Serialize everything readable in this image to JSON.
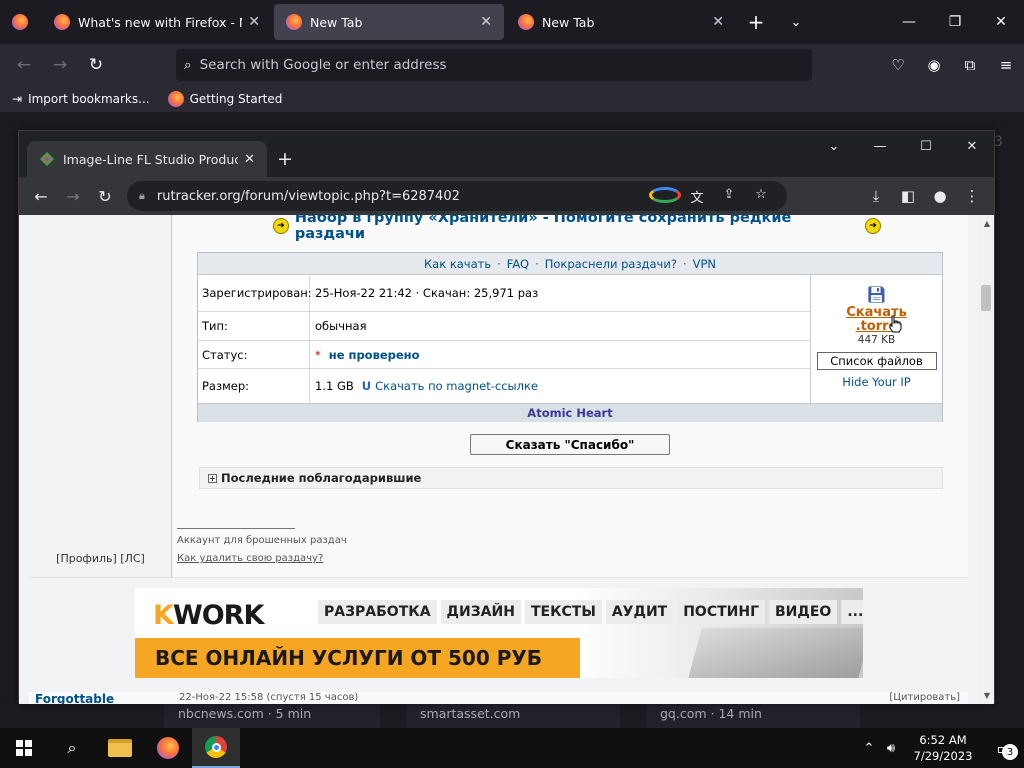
{
  "firefox": {
    "tabs": [
      {
        "title": "What's new with Firefox - More"
      },
      {
        "title": "New Tab",
        "active": true
      },
      {
        "title": "New Tab"
      }
    ],
    "address_placeholder": "Search with Google or enter address",
    "bookmarks": [
      "Import bookmarks...",
      "Getting Started"
    ],
    "bg_news": [
      "nbcnews.com · 5 min",
      "smartasset.com",
      "gq.com · 14 min"
    ],
    "bg_edge_char": "3"
  },
  "chrome": {
    "tab_title": "Image-Line FL Studio Producer E",
    "url": "rutracker.org/forum/viewtopic.php?t=6287402"
  },
  "page": {
    "recruit_banner": "Набор в группу «Хранители» - Помогите сохранить редкие раздачи",
    "links": [
      "Как качать",
      "FAQ",
      "Покраснели раздачи?",
      "VPN"
    ],
    "link_sep": "·",
    "rows": [
      {
        "label": "Зарегистрирован:",
        "value": "25-Ноя-22 21:42 · Скачан: 25,971 раз"
      },
      {
        "label": "Тип:",
        "value": "обычная"
      },
      {
        "label": "Статус:",
        "star": "*",
        "value": "не проверено"
      },
      {
        "label": "Размер:",
        "value": "1.1 GB",
        "magnet": "Скачать по magnet-ссылке"
      }
    ],
    "download": {
      "line1": "Скачать",
      "line2": ".torre",
      "size": "447 KB",
      "file_list": "Список файлов",
      "hide_ip": "Hide Your IP"
    },
    "release_title": "Atomic Heart",
    "thanks_button": "Сказать \"Спасибо\"",
    "last_thanked": "Последние поблагодарившие",
    "signature_1": "Аккаунт для брошенных раздач",
    "signature_2": "Как удалить свою раздачу?",
    "profile_links": "[Профиль]   [ЛС]",
    "ad": {
      "logo_k": "K",
      "logo_rest": "WORK",
      "nav": [
        "РАЗРАБОТКА",
        "ДИЗАЙН",
        "ТЕКСТЫ",
        "АУДИТ",
        "ПОСТИНГ",
        "ВИДЕО",
        "..."
      ],
      "headline": "ВСЕ ОНЛАЙН УСЛУГИ ОТ 500 РУБ"
    },
    "next_post": {
      "user": "Forgottable",
      "date": "22-Ноя-22 15:58",
      "ago": "(спустя 15 часов)",
      "cite": "[Цитировать]"
    }
  },
  "taskbar": {
    "time": "6:52 AM",
    "date": "7/29/2023",
    "notifications": "3"
  }
}
